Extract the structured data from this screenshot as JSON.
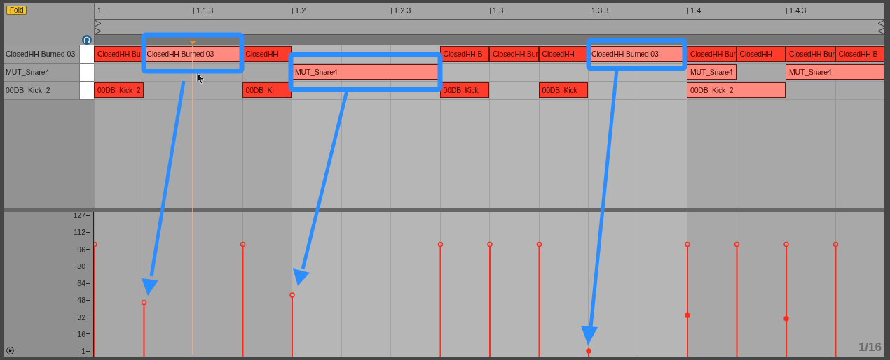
{
  "fold_button": {
    "label": "Fold"
  },
  "ruler": [
    "1",
    "1.1.3",
    "1.2",
    "1.2.3",
    "1.3",
    "1.3.3",
    "1.4",
    "1.4.3"
  ],
  "tracks": [
    {
      "name": "ClosedHH Burned 03",
      "notes": [
        {
          "text": "ClosedHH Bu",
          "selected": false
        },
        {
          "text": "ClosedHH Burned 03",
          "selected": true
        },
        {
          "text": "ClosedHH",
          "selected": false
        },
        {
          "text": "ClosedHH B",
          "selected": false
        },
        {
          "text": "ClosedHH Bur",
          "selected": false
        },
        {
          "text": "ClosedHH",
          "selected": false
        },
        {
          "text": "ClosedHH Burned 03",
          "selected": true
        },
        {
          "text": "ClosedHH Bur",
          "selected": false
        },
        {
          "text": "ClosedHH",
          "selected": false
        },
        {
          "text": "ClosedHH Bur",
          "selected": false
        },
        {
          "text": "ClosedHH B",
          "selected": false
        }
      ]
    },
    {
      "name": "MUT_Snare4",
      "notes": [
        {
          "text": "MUT_Snare4",
          "selected": true
        },
        {
          "text": "MUT_Snare4",
          "selected": true
        },
        {
          "text": "MUT_Snare4",
          "selected": true
        }
      ]
    },
    {
      "name": "00DB_Kick_2",
      "notes": [
        {
          "text": "00DB_Kick_2",
          "selected": false
        },
        {
          "text": "00DB_Ki",
          "selected": false
        },
        {
          "text": "00DB_Kick",
          "selected": false
        },
        {
          "text": "00DB_Kick",
          "selected": false
        },
        {
          "text": "00DB_Kick_2",
          "selected": true
        }
      ]
    }
  ],
  "velocity_lane": {
    "axis_labels": [
      "127",
      "112",
      "96",
      "80",
      "64",
      "48",
      "32",
      "16",
      "1"
    ],
    "grid_label": "1/16"
  }
}
